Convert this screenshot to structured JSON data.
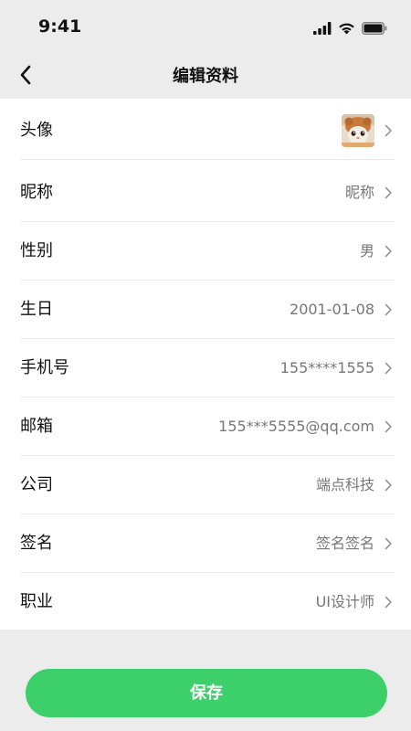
{
  "status_bar": {
    "time": "9:41"
  },
  "nav": {
    "title": "编辑资料"
  },
  "fields": [
    {
      "label": "头像",
      "value": ""
    },
    {
      "label": "昵称",
      "value": "昵称"
    },
    {
      "label": "性别",
      "value": "男"
    },
    {
      "label": "生日",
      "value": "2001-01-08"
    },
    {
      "label": "手机号",
      "value": "155****1555"
    },
    {
      "label": "邮箱",
      "value": "155***5555@qq.com"
    },
    {
      "label": "公司",
      "value": "端点科技"
    },
    {
      "label": "签名",
      "value": "签名签名"
    },
    {
      "label": "职业",
      "value": "UI设计师"
    }
  ],
  "save_label": "保存",
  "colors": {
    "accent": "#3ccf6a",
    "background": "#ececec",
    "value_text": "#777777"
  },
  "icons": {
    "back": "chevron-left-icon",
    "row_arrow": "chevron-right-icon",
    "signal": "signal-icon",
    "wifi": "wifi-icon",
    "battery": "battery-icon"
  }
}
